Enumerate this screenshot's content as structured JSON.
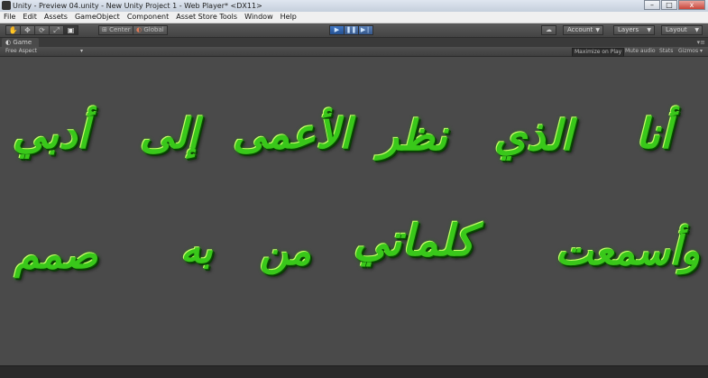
{
  "window": {
    "title": "Unity - Preview 04.unity - New Unity Project 1 - Web Player* <DX11>",
    "buttons": {
      "minimize": "–",
      "maximize": "□",
      "close": "x"
    }
  },
  "menu": [
    "File",
    "Edit",
    "Assets",
    "GameObject",
    "Component",
    "Asset Store Tools",
    "Window",
    "Help"
  ],
  "toolbar": {
    "pivot": "Center",
    "space": "Global",
    "account": "Account",
    "layers": "Layers",
    "layout": "Layout"
  },
  "game_tab": {
    "label": "Game"
  },
  "game_bar": {
    "aspect": "Free Aspect",
    "maximize_on_play": "Maximize on Play",
    "mute_audio": "Mute audio",
    "stats": "Stats",
    "gizmos": "Gizmos"
  },
  "poem": {
    "line1": [
      "أنا",
      "الذي",
      "نظر",
      "الأعمى",
      "إلى",
      "أدبي"
    ],
    "line2": [
      "وأسمعت",
      "كلماتي",
      "من",
      "به",
      "صمم"
    ]
  },
  "colors": {
    "text_green": "#39c81a",
    "play_blue": "#3f76c4",
    "editor_bg": "#444444"
  }
}
